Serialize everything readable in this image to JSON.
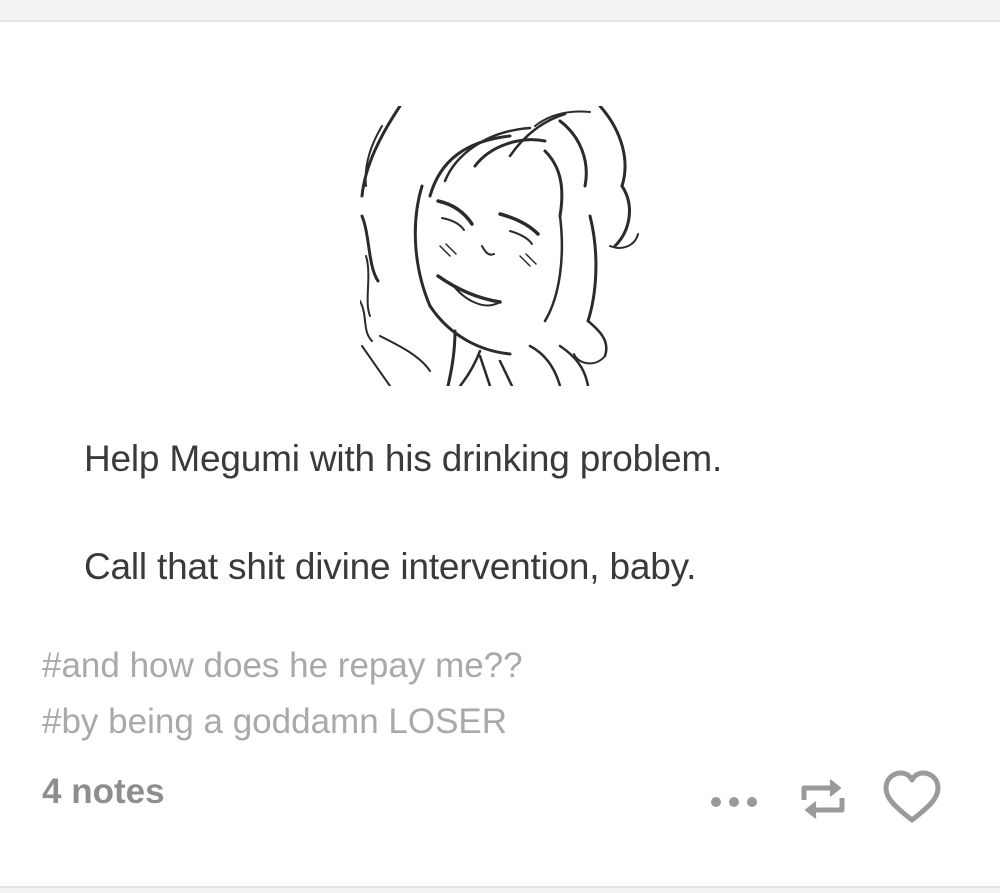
{
  "post": {
    "body_lines": [
      "Help Megumi with his drinking problem.",
      "Call that shit divine intervention, baby."
    ],
    "tags": [
      "#and how does he repay me??",
      "#by being a goddamn LOSER"
    ],
    "notes": "4 notes"
  },
  "icons": {
    "more": "more-dots-icon",
    "reblog": "reblog-icon",
    "like": "heart-icon"
  },
  "colors": {
    "background": "#f2f2f2",
    "card": "#ffffff",
    "body_text": "#3a3a3a",
    "tag_text": "#a9a9a9",
    "notes_text": "#8e8e8e",
    "icon": "#9a9a9a"
  }
}
